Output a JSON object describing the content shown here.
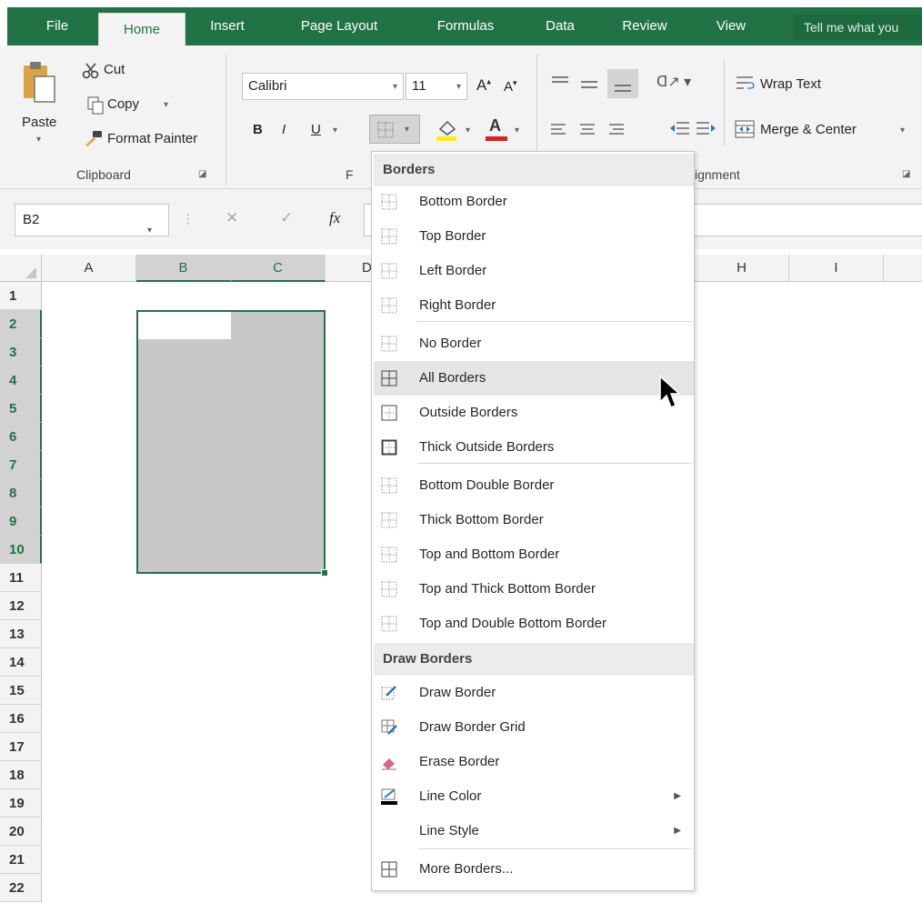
{
  "ribbon_tabs": [
    "File",
    "Home",
    "Insert",
    "Page Layout",
    "Formulas",
    "Data",
    "Review",
    "View"
  ],
  "active_tab": "Home",
  "tell_me": "Tell me what you",
  "clipboard": {
    "paste": "Paste",
    "cut": "Cut",
    "copy": "Copy",
    "format_painter": "Format Painter",
    "group_label": "Clipboard"
  },
  "font": {
    "name": "Calibri",
    "size": "11",
    "bold": "B",
    "italic": "I",
    "underline": "U",
    "group_label_partial": "F"
  },
  "alignment": {
    "wrap_text": "Wrap Text",
    "merge_center": "Merge & Center",
    "group_label_partial": "ignment"
  },
  "formula_bar": {
    "name_box": "B2",
    "fx": "fx"
  },
  "columns": [
    "A",
    "B",
    "C",
    "D",
    "H",
    "I"
  ],
  "selected_columns": [
    "B",
    "C"
  ],
  "rows": [
    "1",
    "2",
    "3",
    "4",
    "5",
    "6",
    "7",
    "8",
    "9",
    "10",
    "11",
    "12",
    "13",
    "14",
    "15",
    "16",
    "17",
    "18",
    "19",
    "20",
    "21",
    "22"
  ],
  "selected_rows": [
    "2",
    "3",
    "4",
    "5",
    "6",
    "7",
    "8",
    "9",
    "10"
  ],
  "menu": {
    "borders_header": "Borders",
    "borders_items": [
      "Bottom Border",
      "Top Border",
      "Left Border",
      "Right Border",
      "No Border",
      "All Borders",
      "Outside Borders",
      "Thick Outside Borders",
      "Bottom Double Border",
      "Thick Bottom Border",
      "Top and Bottom Border",
      "Top and Thick Bottom Border",
      "Top and Double Bottom Border"
    ],
    "highlighted_item": "All Borders",
    "draw_header": "Draw Borders",
    "draw_items": [
      "Draw Border",
      "Draw Border Grid",
      "Erase Border",
      "Line Color",
      "Line Style",
      "More Borders..."
    ]
  },
  "colors": {
    "excel_green": "#217346",
    "selection_fill": "#c8c8c8",
    "menu_highlight": "#e5e5e5"
  }
}
